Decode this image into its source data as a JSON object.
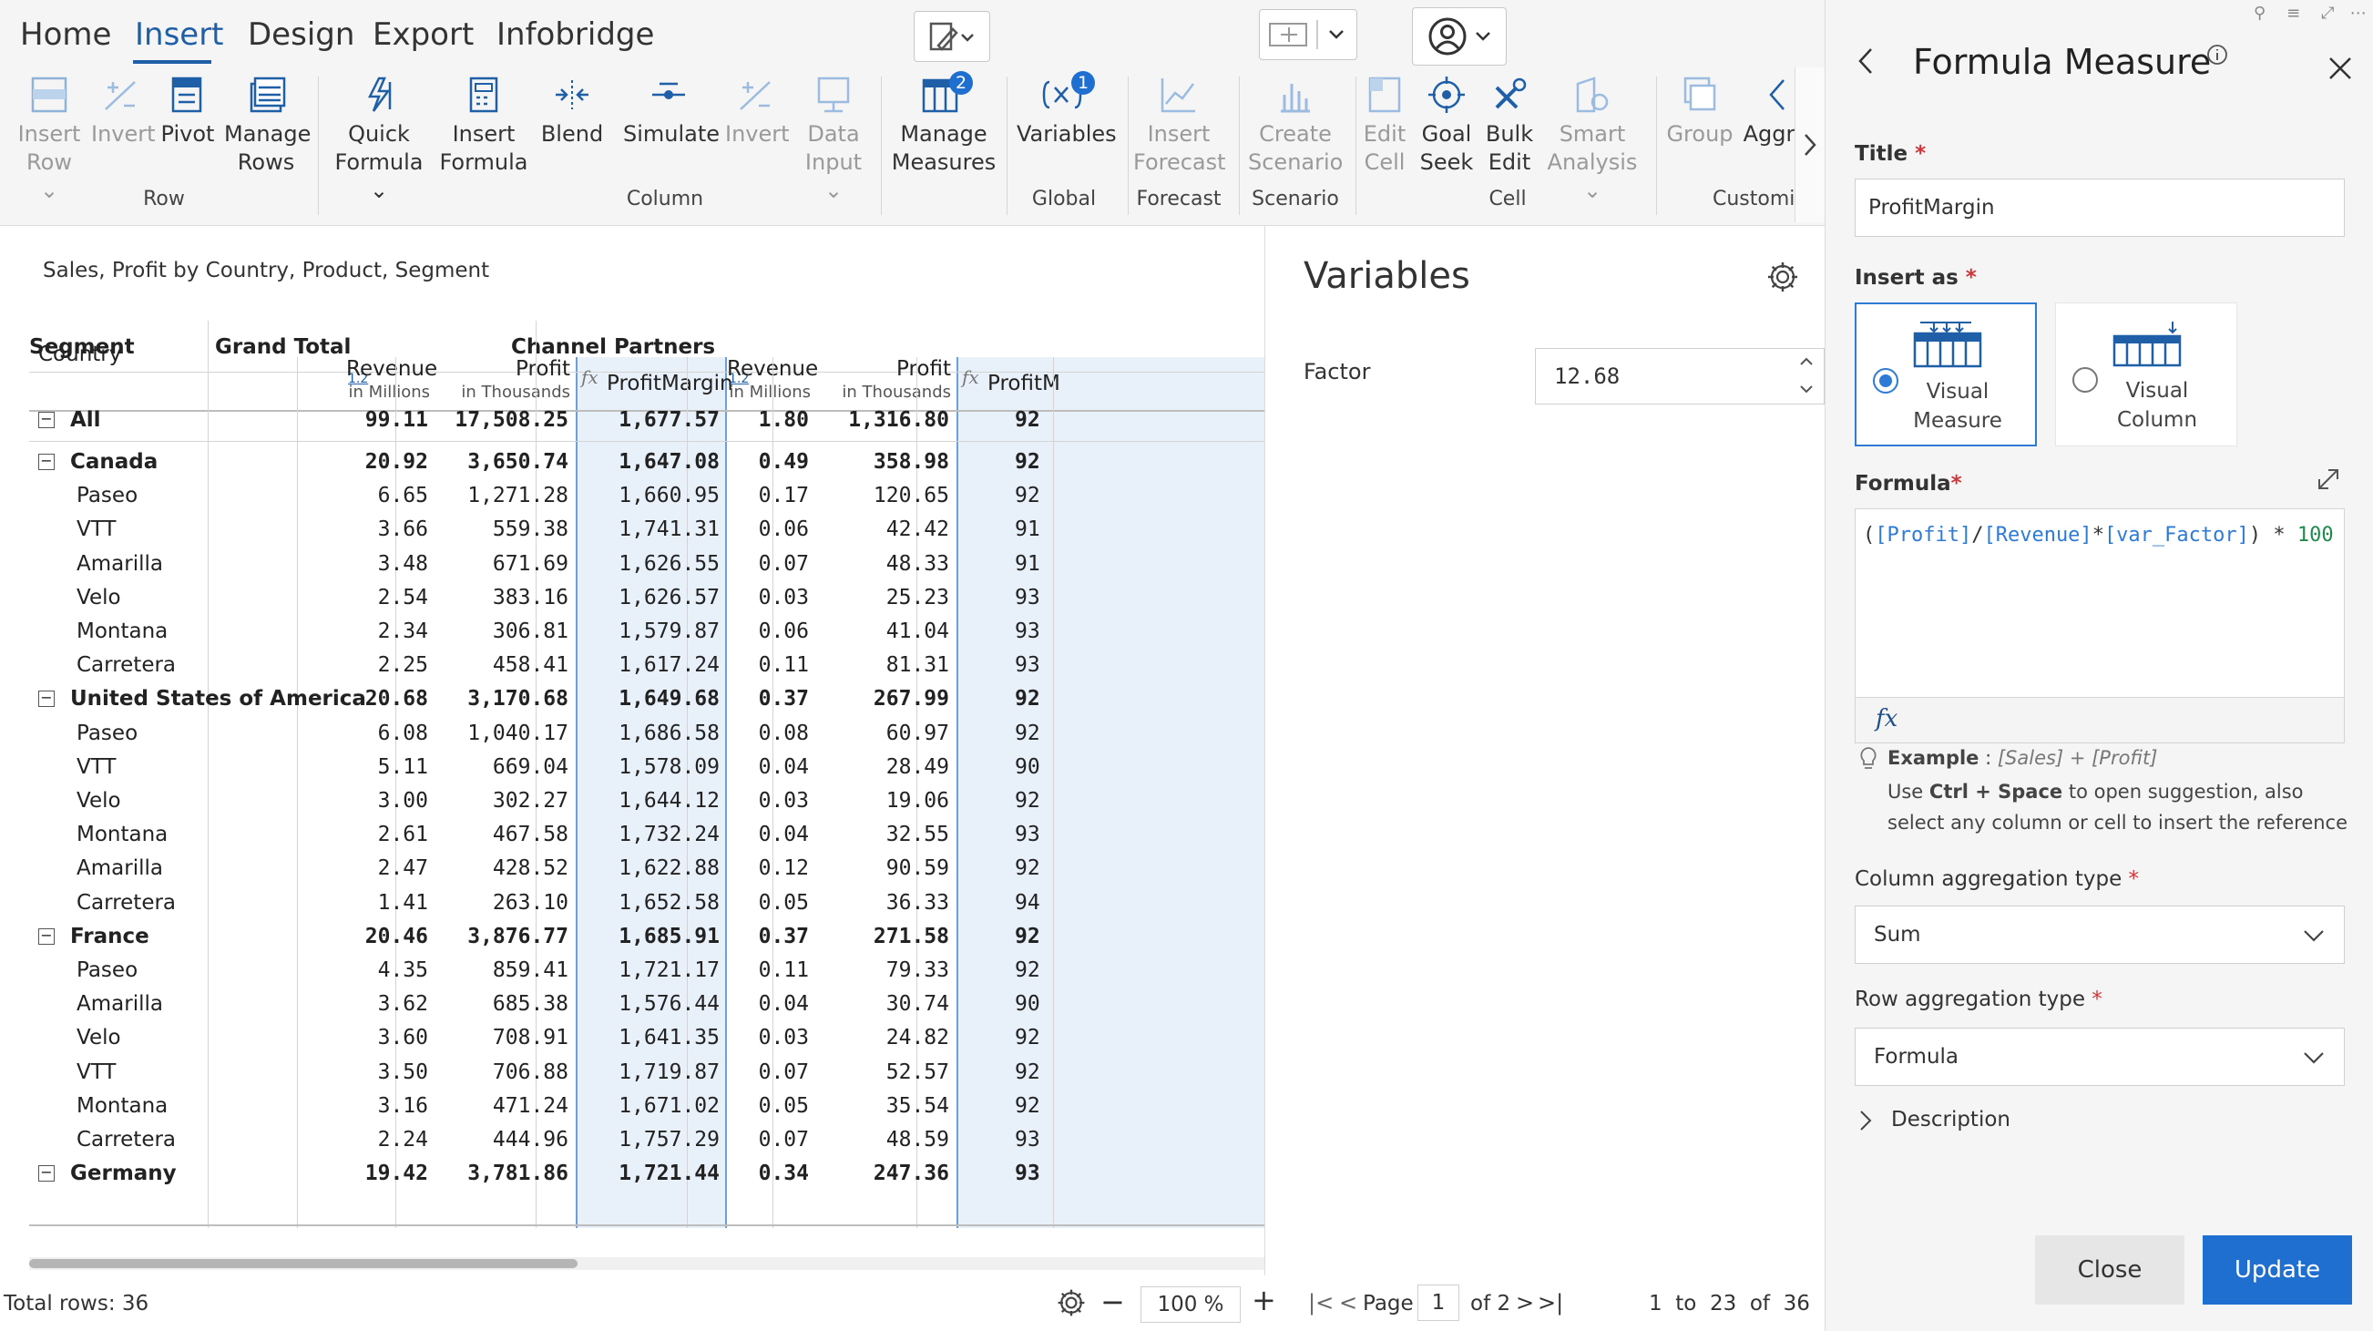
{
  "tabs": [
    {
      "label": "Home"
    },
    {
      "label": "Insert"
    },
    {
      "label": "Design"
    },
    {
      "label": "Export"
    },
    {
      "label": "Infobridge"
    }
  ],
  "ribbon": {
    "buttons": [
      {
        "line1": "Insert",
        "line2": "Row",
        "dropdown": true,
        "disabled": true,
        "icon": "insert-row-icon"
      },
      {
        "line1": "Invert",
        "line2": "",
        "disabled": true,
        "icon": "invert-icon"
      },
      {
        "line1": "Pivot",
        "line2": "",
        "disabled": false,
        "icon": "pivot-icon"
      },
      {
        "line1": "Manage",
        "line2": "Rows",
        "disabled": false,
        "icon": "manage-rows-icon"
      },
      {
        "line1": "Quick",
        "line2": "Formula",
        "dropdown": true,
        "disabled": false,
        "icon": "quick-formula-icon"
      },
      {
        "line1": "Insert",
        "line2": "Formula",
        "disabled": false,
        "icon": "insert-formula-icon"
      },
      {
        "line1": "Blend",
        "line2": "",
        "disabled": false,
        "icon": "blend-icon"
      },
      {
        "line1": "Simulate",
        "line2": "",
        "disabled": false,
        "icon": "simulate-icon"
      },
      {
        "line1": "Invert",
        "line2": "",
        "disabled": true,
        "icon": "invert-icon"
      },
      {
        "line1": "Data",
        "line2": "Input",
        "dropdown": true,
        "disabled": true,
        "icon": "data-input-icon"
      },
      {
        "line1": "Manage",
        "line2": "Measures",
        "disabled": false,
        "icon": "manage-measures-icon",
        "badge": "2"
      },
      {
        "line1": "Variables",
        "line2": "",
        "disabled": false,
        "icon": "variables-icon",
        "badge": "1"
      },
      {
        "line1": "Insert",
        "line2": "Forecast",
        "disabled": true,
        "icon": "insert-forecast-icon"
      },
      {
        "line1": "Create",
        "line2": "Scenario",
        "disabled": true,
        "icon": "create-scenario-icon"
      },
      {
        "line1": "Edit",
        "line2": "Cell",
        "disabled": true,
        "icon": "edit-cell-icon"
      },
      {
        "line1": "Goal",
        "line2": "Seek",
        "disabled": false,
        "icon": "goal-seek-icon"
      },
      {
        "line1": "Bulk",
        "line2": "Edit",
        "disabled": false,
        "icon": "bulk-edit-icon"
      },
      {
        "line1": "Smart",
        "line2": "Analysis",
        "dropdown": true,
        "disabled": true,
        "icon": "smart-analysis-icon"
      },
      {
        "line1": "Group",
        "line2": "",
        "disabled": true,
        "icon": "group-icon"
      },
      {
        "line1": "Aggr",
        "line2": "",
        "disabled": false,
        "icon": "aggregate-icon"
      }
    ],
    "groups": [
      "Row",
      "Column",
      "Global",
      "Forecast",
      "Scenario",
      "Cell",
      "Customi"
    ]
  },
  "report": {
    "subtitle": "Sales, Profit by Country, Product, Segment",
    "headers": {
      "segment": "Segment",
      "country": "Country",
      "grand_total": "Grand Total",
      "channel_partners": "Channel Partners",
      "revenue": "Revenue",
      "revenue_sub": "in Millions",
      "profit": "Profit",
      "profit_sub": "in Thousands",
      "profit_margin": "ProfitMargin",
      "profit_margin_cut": "ProfitM",
      "num_icon": "1.2"
    },
    "rows": [
      {
        "label": "All",
        "bold": true,
        "collapse": true,
        "indent": 0,
        "v": [
          "99.11",
          "17,508.25",
          "1,677.57",
          "1.80",
          "1,316.80",
          "92"
        ]
      },
      {
        "label": "Canada",
        "bold": true,
        "collapse": true,
        "indent": 0,
        "v": [
          "20.92",
          "3,650.74",
          "1,647.08",
          "0.49",
          "358.98",
          "92"
        ]
      },
      {
        "label": "Paseo",
        "bold": false,
        "indent": 1,
        "v": [
          "6.65",
          "1,271.28",
          "1,660.95",
          "0.17",
          "120.65",
          "92"
        ]
      },
      {
        "label": "VTT",
        "bold": false,
        "indent": 1,
        "v": [
          "3.66",
          "559.38",
          "1,741.31",
          "0.06",
          "42.42",
          "91"
        ]
      },
      {
        "label": "Amarilla",
        "bold": false,
        "indent": 1,
        "v": [
          "3.48",
          "671.69",
          "1,626.55",
          "0.07",
          "48.33",
          "91"
        ]
      },
      {
        "label": "Velo",
        "bold": false,
        "indent": 1,
        "v": [
          "2.54",
          "383.16",
          "1,626.57",
          "0.03",
          "25.23",
          "93"
        ]
      },
      {
        "label": "Montana",
        "bold": false,
        "indent": 1,
        "v": [
          "2.34",
          "306.81",
          "1,579.87",
          "0.06",
          "41.04",
          "93"
        ]
      },
      {
        "label": "Carretera",
        "bold": false,
        "indent": 1,
        "v": [
          "2.25",
          "458.41",
          "1,617.24",
          "0.11",
          "81.31",
          "93"
        ]
      },
      {
        "label": "United States of America",
        "bold": true,
        "collapse": true,
        "indent": 0,
        "v": [
          "20.68",
          "3,170.68",
          "1,649.68",
          "0.37",
          "267.99",
          "92"
        ]
      },
      {
        "label": "Paseo",
        "bold": false,
        "indent": 1,
        "v": [
          "6.08",
          "1,040.17",
          "1,686.58",
          "0.08",
          "60.97",
          "92"
        ]
      },
      {
        "label": "VTT",
        "bold": false,
        "indent": 1,
        "v": [
          "5.11",
          "669.04",
          "1,578.09",
          "0.04",
          "28.49",
          "90"
        ]
      },
      {
        "label": "Velo",
        "bold": false,
        "indent": 1,
        "v": [
          "3.00",
          "302.27",
          "1,644.12",
          "0.03",
          "19.06",
          "92"
        ]
      },
      {
        "label": "Montana",
        "bold": false,
        "indent": 1,
        "v": [
          "2.61",
          "467.58",
          "1,732.24",
          "0.04",
          "32.55",
          "93"
        ]
      },
      {
        "label": "Amarilla",
        "bold": false,
        "indent": 1,
        "v": [
          "2.47",
          "428.52",
          "1,622.88",
          "0.12",
          "90.59",
          "92"
        ]
      },
      {
        "label": "Carretera",
        "bold": false,
        "indent": 1,
        "v": [
          "1.41",
          "263.10",
          "1,652.58",
          "0.05",
          "36.33",
          "94"
        ]
      },
      {
        "label": "France",
        "bold": true,
        "collapse": true,
        "indent": 0,
        "v": [
          "20.46",
          "3,876.77",
          "1,685.91",
          "0.37",
          "271.58",
          "92"
        ]
      },
      {
        "label": "Paseo",
        "bold": false,
        "indent": 1,
        "v": [
          "4.35",
          "859.41",
          "1,721.17",
          "0.11",
          "79.33",
          "92"
        ]
      },
      {
        "label": "Amarilla",
        "bold": false,
        "indent": 1,
        "v": [
          "3.62",
          "685.38",
          "1,576.44",
          "0.04",
          "30.74",
          "90"
        ]
      },
      {
        "label": "Velo",
        "bold": false,
        "indent": 1,
        "v": [
          "3.60",
          "708.91",
          "1,641.35",
          "0.03",
          "24.82",
          "92"
        ]
      },
      {
        "label": "VTT",
        "bold": false,
        "indent": 1,
        "v": [
          "3.50",
          "706.88",
          "1,719.87",
          "0.07",
          "52.57",
          "92"
        ]
      },
      {
        "label": "Montana",
        "bold": false,
        "indent": 1,
        "v": [
          "3.16",
          "471.24",
          "1,671.02",
          "0.05",
          "35.54",
          "92"
        ]
      },
      {
        "label": "Carretera",
        "bold": false,
        "indent": 1,
        "v": [
          "2.24",
          "444.96",
          "1,757.29",
          "0.07",
          "48.59",
          "93"
        ]
      },
      {
        "label": "Germany",
        "bold": true,
        "collapse": true,
        "indent": 0,
        "v": [
          "19.42",
          "3,781.86",
          "1,721.44",
          "0.34",
          "247.36",
          "93"
        ]
      }
    ]
  },
  "variables": {
    "title": "Variables",
    "factor_label": "Factor",
    "factor_value": "12.68"
  },
  "footer": {
    "total_rows": "Total rows: 36",
    "zoom": "100 %",
    "page_label": "Page",
    "page_value": "1",
    "page_of": "of 2",
    "range": "1  to  23  of  36"
  },
  "panel": {
    "title": "Formula Measure",
    "title_label": "Title",
    "title_value": "ProfitMargin",
    "insert_as_label": "Insert as",
    "insert_options": [
      {
        "line1": "Visual",
        "line2": "Measure",
        "selected": true
      },
      {
        "line1": "Visual",
        "line2": "Column",
        "selected": false
      }
    ],
    "formula_label": "Formula",
    "formula_parts": [
      {
        "t": "(",
        "c": "#333333"
      },
      {
        "t": "[Profit]",
        "c": "#2e7bd6"
      },
      {
        "t": "/",
        "c": "#333333"
      },
      {
        "t": "[Revenue]",
        "c": "#2e7bd6"
      },
      {
        "t": "*",
        "c": "#333333"
      },
      {
        "t": "[var_Factor]",
        "c": "#2e7bd6"
      },
      {
        "t": ") * ",
        "c": "#333333"
      },
      {
        "t": "100",
        "c": "#1e8a4c"
      }
    ],
    "fx": "fx",
    "example_label": "Example",
    "example_value": "[Sales] + [Profit]",
    "hint_pre": "Use ",
    "hint_keys": "Ctrl + Space",
    "hint_post": " to open suggestion, also select any column or cell to insert the reference",
    "col_agg_label": "Column aggregation type",
    "col_agg_value": "Sum",
    "row_agg_label": "Row aggregation type",
    "row_agg_value": "Formula",
    "description_label": "Description",
    "close_label": "Close",
    "update_label": "Update"
  },
  "colors": {
    "accent": "#1f6fd1",
    "highlight_column": "#e8f0fa"
  }
}
